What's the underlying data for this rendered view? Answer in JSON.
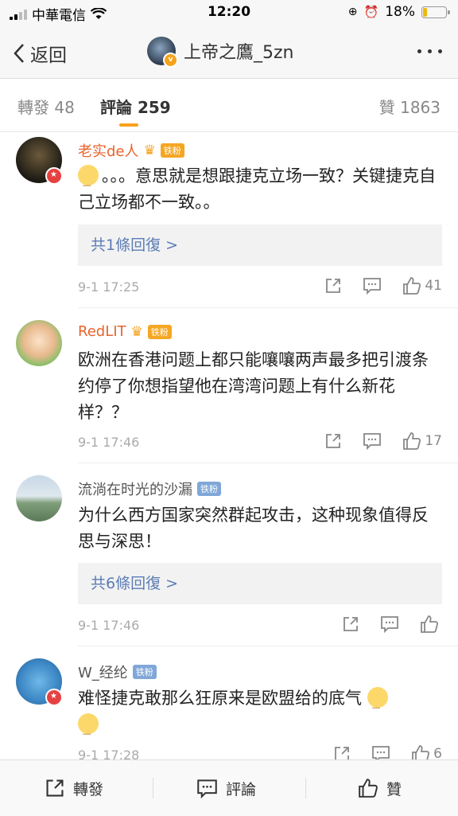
{
  "status_bar": {
    "carrier": "中華電信",
    "time": "12:20",
    "battery": "18%",
    "battery_fraction": 0.18
  },
  "nav": {
    "back_label": "返回",
    "title": "上帝之鷹_5zn"
  },
  "tabs": {
    "repost": "轉發 48",
    "comments": "評論 259",
    "likes": "贊 1863"
  },
  "comments": [
    {
      "username": "老实de人",
      "fan_badge": "铁粉",
      "text_parts": [
        "。。。意思就是想跟捷克立场一致？关键捷克自己立场都不一致。。"
      ],
      "reply": "共1條回復 >",
      "time": "9-1 17:25",
      "likes": "41"
    },
    {
      "username": "RedLIT",
      "fan_badge": "铁粉",
      "text": "欧洲在香港问题上都只能嚷嚷两声最多把引渡条约停了你想指望他在湾湾问题上有什么新花样？？",
      "time": "9-1 17:46",
      "likes": "17"
    },
    {
      "username": "流淌在时光的沙漏",
      "fan_badge": "铁粉",
      "text": "为什么西方国家突然群起攻击，这种现象值得反思与深思！",
      "reply": "共6條回復 >",
      "time": "9-1 17:46",
      "likes": ""
    },
    {
      "username": "W_经纶",
      "fan_badge": "铁粉",
      "text": "难怪捷克敢那么狂原来是欧盟给的底气",
      "time": "9-1 17:28",
      "likes": "6"
    }
  ],
  "bottom_bar": {
    "repost": "轉發",
    "comment": "評論",
    "like": "贊"
  },
  "colors": {
    "accent": "#f7a21b",
    "link": "#5b7cb5",
    "username_orange": "#e8632c"
  }
}
